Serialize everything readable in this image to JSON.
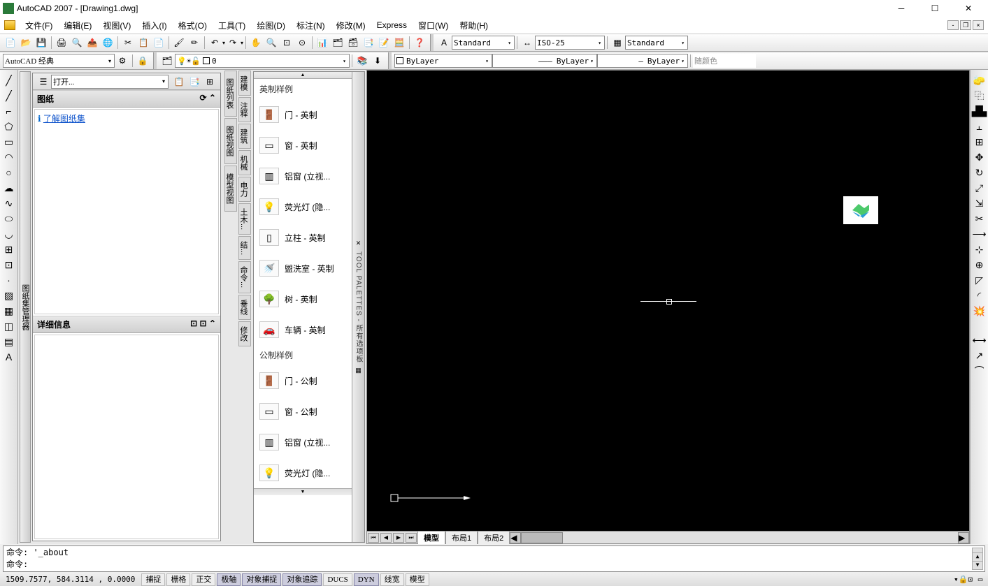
{
  "app": {
    "title": "AutoCAD 2007 - [Drawing1.dwg]"
  },
  "menu": {
    "file": "文件(F)",
    "edit": "编辑(E)",
    "view": "视图(V)",
    "insert": "插入(I)",
    "format": "格式(O)",
    "tools": "工具(T)",
    "draw": "绘图(D)",
    "dim": "标注(N)",
    "modify": "修改(M)",
    "express": "Express",
    "window": "窗口(W)",
    "help": "帮助(H)"
  },
  "toolbar2": {
    "text_style": "Standard",
    "dim_style": "ISO-25",
    "table_style": "Standard"
  },
  "workspace": {
    "name": "AutoCAD 经典"
  },
  "layer": {
    "current": "0"
  },
  "props": {
    "color": "ByLayer",
    "linetype": "ByLayer",
    "lineweight": "ByLayer",
    "plotstyle": "随颜色"
  },
  "sheetset": {
    "open_label": "打开...",
    "panel1_title": "图纸",
    "panel1_link": "了解图纸集",
    "panel2_title": "详细信息",
    "handle": "图纸集管理器"
  },
  "midtabs_left": [
    "图纸列表",
    "图纸视图",
    "模型视图"
  ],
  "midtabs_right": [
    "建模",
    "注释",
    "建筑",
    "机械",
    "电力",
    "土木...",
    "结...",
    "命令...",
    "垂线",
    "修改"
  ],
  "palette": {
    "handle": "TOOL PALETTES - 所有选项板",
    "section1": "英制样例",
    "items1": [
      "门 - 英制",
      "窗 - 英制",
      "铝窗 (立视...",
      "荧光灯 (隐...",
      "立柱 - 英制",
      "盥洗室 - 英制",
      "树 - 英制",
      "车辆 - 英制"
    ],
    "section2": "公制样例",
    "items2": [
      "门 - 公制",
      "窗 - 公制",
      "铝窗 (立视...",
      "荧光灯 (隐..."
    ]
  },
  "tabs": {
    "model": "模型",
    "layout1": "布局1",
    "layout2": "布局2"
  },
  "cmd": {
    "history": "命令: '_about",
    "prompt": "命令:"
  },
  "status": {
    "coords": "1509.7577, 584.3114 , 0.0000",
    "btns": [
      "捕捉",
      "栅格",
      "正交",
      "极轴",
      "对象捕捉",
      "对象追踪",
      "DUCS",
      "DYN",
      "线宽",
      "模型"
    ]
  }
}
